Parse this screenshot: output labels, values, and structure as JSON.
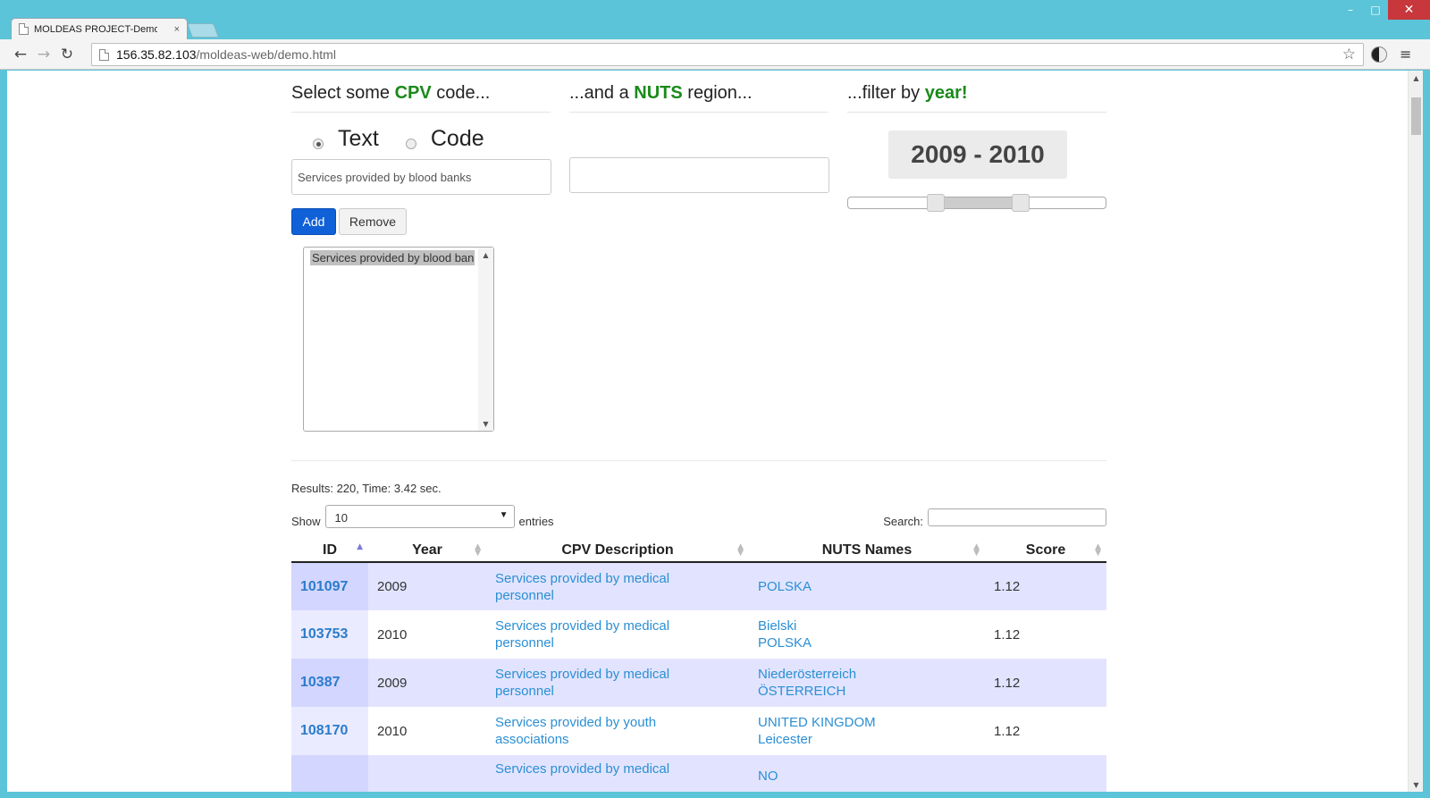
{
  "window": {
    "minimize": "–",
    "maximize": "□",
    "close": "✕"
  },
  "tab": {
    "title": "MOLDEAS PROJECT-Demo",
    "close": "×"
  },
  "address": {
    "host": "156.35.82.103",
    "path": "/moldeas-web/demo.html"
  },
  "nav": {
    "back": "←",
    "forward": "→",
    "reload": "↻",
    "star": "☆",
    "menu": "≡"
  },
  "cpv": {
    "heading_pre": "Select some ",
    "heading_bold": "CPV",
    "heading_post": " code...",
    "radio_text": "Text",
    "radio_code": "Code",
    "selected_radio": "Text",
    "input_value": "Services provided by blood banks",
    "add_label": "Add",
    "remove_label": "Remove",
    "list_items": [
      "Services provided by blood banks"
    ]
  },
  "nuts": {
    "heading_pre": "...and a ",
    "heading_bold": "NUTS",
    "heading_post": " region...",
    "input_value": ""
  },
  "year": {
    "heading_pre": "...filter by ",
    "heading_bold": "year!",
    "range_label": "2009 - 2010",
    "range_start": 2009,
    "range_end": 2010
  },
  "results": {
    "summary": "Results: 220, Time: 3.42 sec.",
    "show_label": "Show",
    "entries_value": "10",
    "entries_label": "entries",
    "search_label": "Search:",
    "search_value": ""
  },
  "table": {
    "columns": [
      "ID",
      "Year",
      "CPV Description",
      "NUTS Names",
      "Score"
    ],
    "rows": [
      {
        "id": "101097",
        "year": "2009",
        "cpv": [
          "Services provided by medical",
          "personnel"
        ],
        "nuts": [
          "POLSKA",
          ""
        ],
        "score": "1.12"
      },
      {
        "id": "103753",
        "year": "2010",
        "cpv": [
          "Services provided by medical",
          "personnel"
        ],
        "nuts": [
          "Bielski",
          "POLSKA"
        ],
        "score": "1.12"
      },
      {
        "id": "10387",
        "year": "2009",
        "cpv": [
          "Services provided by medical",
          "personnel"
        ],
        "nuts": [
          "Niederösterreich",
          "ÖSTERREICH"
        ],
        "score": "1.12"
      },
      {
        "id": "108170",
        "year": "2010",
        "cpv": [
          "Services provided by youth",
          "associations"
        ],
        "nuts": [
          "UNITED KINGDOM",
          "Leicester"
        ],
        "score": "1.12"
      },
      {
        "id": "",
        "year": "",
        "cpv": [
          "Services provided by medical",
          ""
        ],
        "nuts": [
          "NO",
          ""
        ],
        "score": ""
      }
    ]
  },
  "colors": {
    "accent_green": "#1a8a1a",
    "link_blue": "#2b8fd4",
    "add_button": "#1060d8",
    "row_highlight": "#e2e4ff"
  }
}
